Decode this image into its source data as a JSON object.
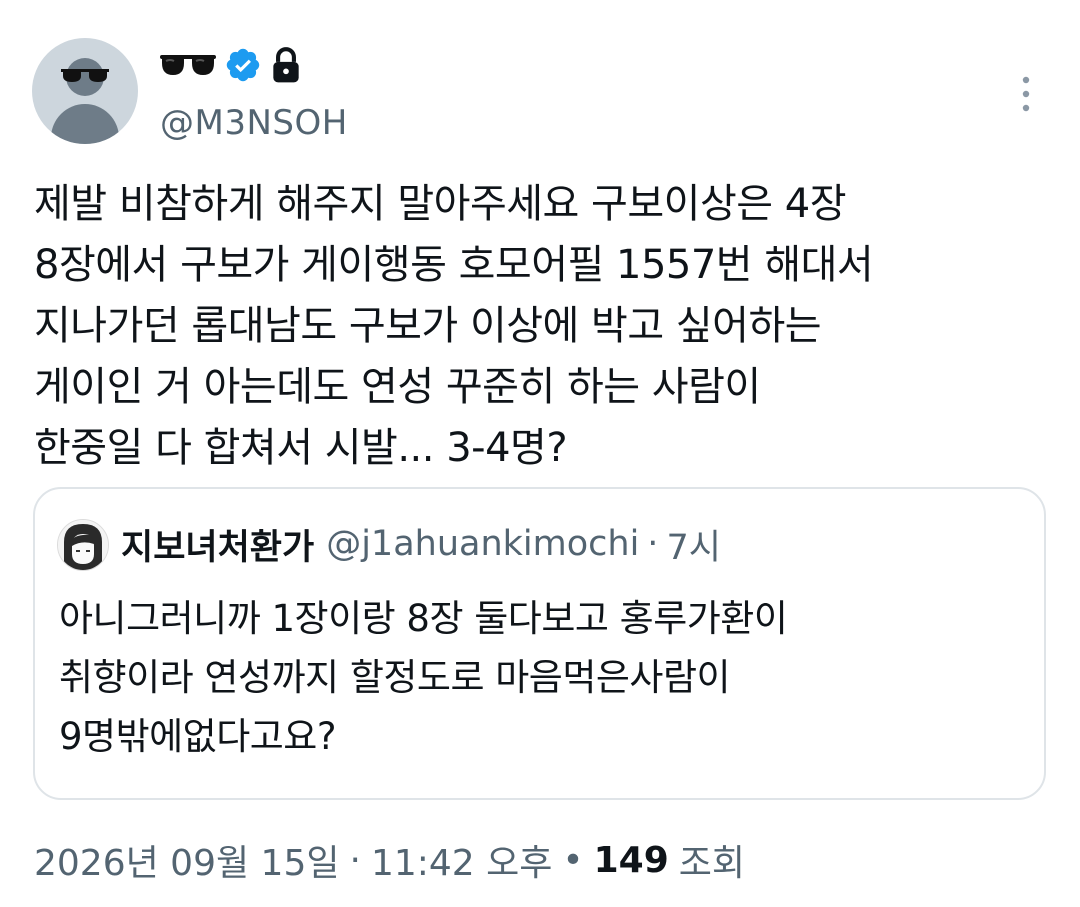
{
  "author": {
    "handle": "@M3NSOH",
    "display_name_icon": "sunglasses-emoji-icon",
    "verified_icon": "verified-badge-icon",
    "protected_icon": "lock-icon",
    "accent_color": "#1d9bf0"
  },
  "tweet": {
    "text": "제발 비참하게 해주지 말아주세요 구보이상은 4장\n8장에서 구보가 게이행동 호모어필 1557번 해대서\n지나가던 롭대남도 구보가 이상에 박고 싶어하는\n게이인 거 아는데도 연성 꾸준히 하는 사람이\n한중일 다 합쳐서 시발... 3-4명?",
    "more_icon": "more-options-icon"
  },
  "quoted_tweet": {
    "display_name": "지보녀처환가",
    "handle": "@j1ahuankimochi",
    "separator": "·",
    "time": "7시",
    "text": "아니그러니까 1장이랑 8장 둘다보고 홍루가환이\n취향이라 연성까지 할정도로 마음먹은사람이\n9명밖에없다고요?"
  },
  "meta": {
    "date": "2026년 09월 15일",
    "sep1": "·",
    "time": "11:42 오후",
    "sep2": "•",
    "views_count": "149",
    "views_label": "조회"
  }
}
